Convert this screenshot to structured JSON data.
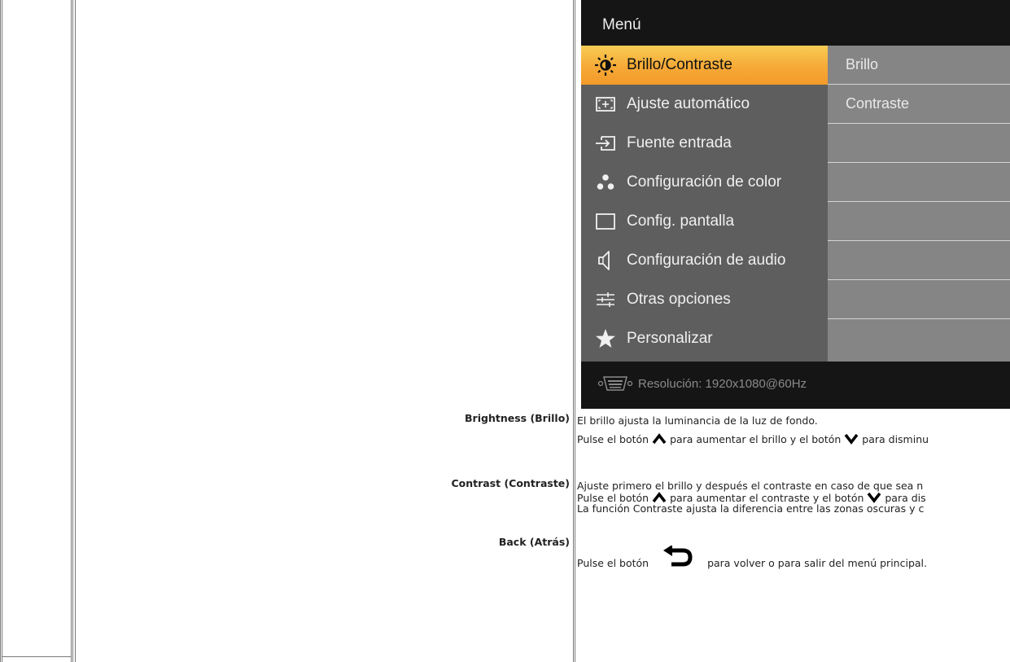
{
  "osd": {
    "title": "Menú",
    "menu_items": [
      {
        "label": "Brillo/Contraste",
        "icon": "brightness-icon",
        "active": true
      },
      {
        "label": "Ajuste automático",
        "icon": "auto-adjust-icon"
      },
      {
        "label": "Fuente entrada",
        "icon": "input-source-icon"
      },
      {
        "label": "Configuración de color",
        "icon": "color-dots-icon"
      },
      {
        "label": "Config. pantalla",
        "icon": "display-icon"
      },
      {
        "label": "Configuración de audio",
        "icon": "speaker-icon"
      },
      {
        "label": "Otras opciones",
        "icon": "sliders-icon"
      },
      {
        "label": "Personalizar",
        "icon": "star-icon"
      }
    ],
    "submenu_items": [
      "Brillo",
      "Contraste",
      "",
      "",
      "",
      "",
      "",
      ""
    ],
    "resolution": "Resolución:  1920x1080@60Hz",
    "accent_color": "#f6a936"
  },
  "rows": [
    {
      "label": "Brightness (Brillo)",
      "line1": "El brillo ajusta la luminancia de la luz de fondo.",
      "line2_a": "Pulse el botón",
      "line2_b": "para aumentar el brillo y el botón",
      "line2_c": "para disminu"
    },
    {
      "label": "Contrast (Contraste)",
      "line1": "Ajuste primero el brillo y después el contraste en caso de que sea n",
      "line2_a": "Pulse el botón",
      "line2_b": "para aumentar el contraste y el botón",
      "line2_c": "para dis",
      "line3": "La función Contraste ajusta la diferencia entre las zonas oscuras y c"
    },
    {
      "label": "Back (Atrás)",
      "line1_a": "Pulse el botón",
      "line1_b": "para volver o para salir del menú principal."
    }
  ]
}
